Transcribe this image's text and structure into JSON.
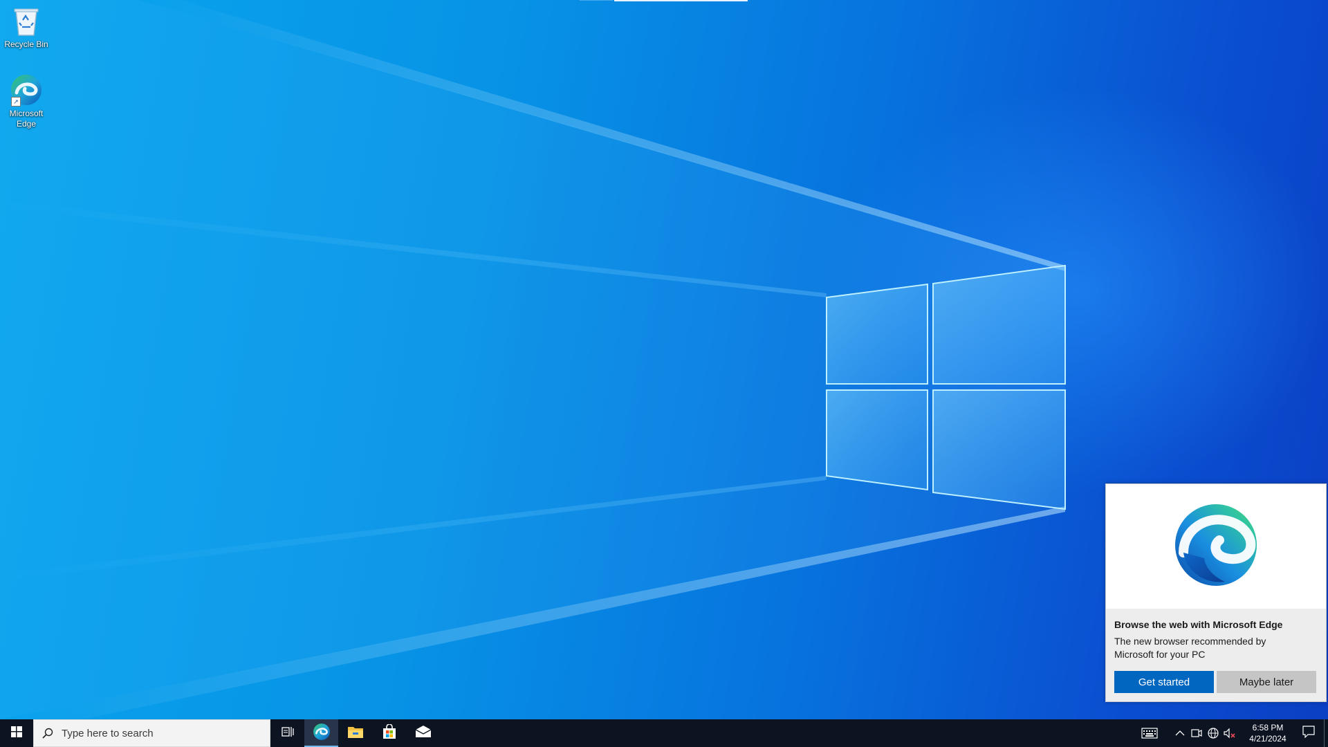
{
  "desktop": {
    "icons": [
      {
        "label": "Recycle Bin",
        "icon": "recycle-bin-icon"
      },
      {
        "label": "Microsoft Edge",
        "icon": "edge-icon"
      }
    ]
  },
  "toast": {
    "title": "Browse the web with Microsoft Edge",
    "body": "The new browser recommended by Microsoft for your PC",
    "primary_button": "Get started",
    "secondary_button": "Maybe later",
    "hero_icon": "edge-logo-icon"
  },
  "taskbar": {
    "search_placeholder": "Type here to search",
    "pinned_apps": [
      {
        "name": "Task View",
        "icon": "task-view-icon"
      },
      {
        "name": "Microsoft Edge",
        "icon": "edge-icon",
        "active": true
      },
      {
        "name": "File Explorer",
        "icon": "file-explorer-icon"
      },
      {
        "name": "Microsoft Store",
        "icon": "store-icon"
      },
      {
        "name": "Mail",
        "icon": "mail-icon"
      }
    ],
    "tray_icons": [
      "keyboard-layout-icon",
      "chevron-up-icon",
      "camera-icon",
      "network-icon",
      "volume-muted-icon"
    ],
    "time": "6:58 PM",
    "date": "4/21/2024"
  },
  "colors": {
    "accent": "#0067c0",
    "taskbar": "#0c1422",
    "wallpaper_light": "#0aa6ee",
    "wallpaper_dark": "#0b3fc4"
  }
}
